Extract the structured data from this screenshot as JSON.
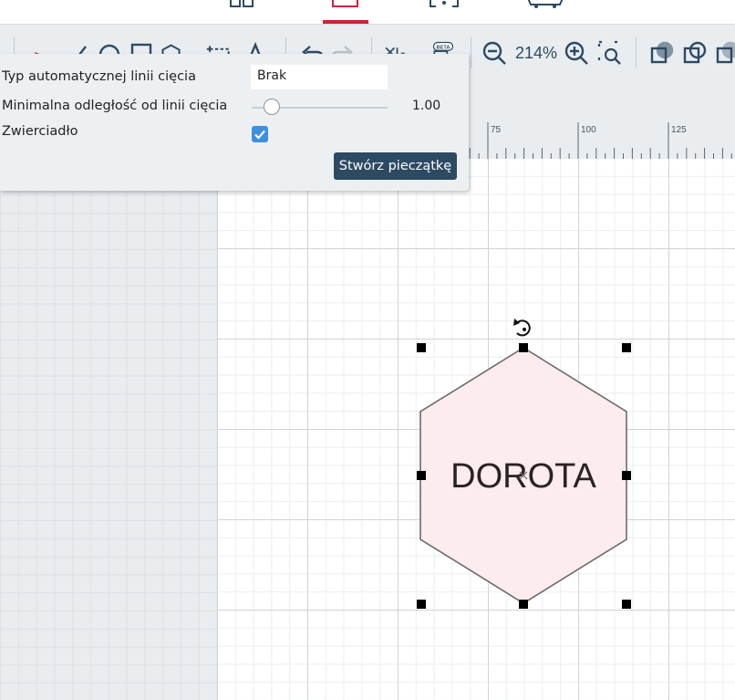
{
  "toolbar": {
    "zoom_level": "214%",
    "beta_badge": "BETA",
    "icons": [
      "select-icon",
      "line-icon",
      "ellipse-icon",
      "rectangle-icon",
      "polygon-icon",
      "add-frame-icon",
      "text-icon",
      "undo-icon",
      "redo-icon",
      "align-icon",
      "beta-feature-icon",
      "zoom-out-icon",
      "zoom-in-icon",
      "zoom-fit-icon",
      "combine-icon",
      "intersect-icon",
      "subtract-icon"
    ]
  },
  "popup": {
    "cutline_type_label": "Typ automatycznej linii cięcia",
    "cutline_type_value": "Brak",
    "min_distance_label": "Minimalna odległość od linii cięcia",
    "min_distance_value": "1.00",
    "min_distance_fraction": 0.15,
    "mirror_label": "Zwierciadło",
    "mirror_checked": true,
    "create_button": "Stwórz pieczątkę"
  },
  "ruler": {
    "labels": [
      "75",
      "100",
      "125"
    ]
  },
  "stamp": {
    "text": "DOROTA",
    "shape": "hexagon",
    "fill": "#fdecee",
    "stroke": "#6b6b6b",
    "text_color": "#2b2222"
  },
  "colors": {
    "accent": "#d0213b",
    "primary": "#2d4a63",
    "checkbox": "#3d8fe0"
  }
}
